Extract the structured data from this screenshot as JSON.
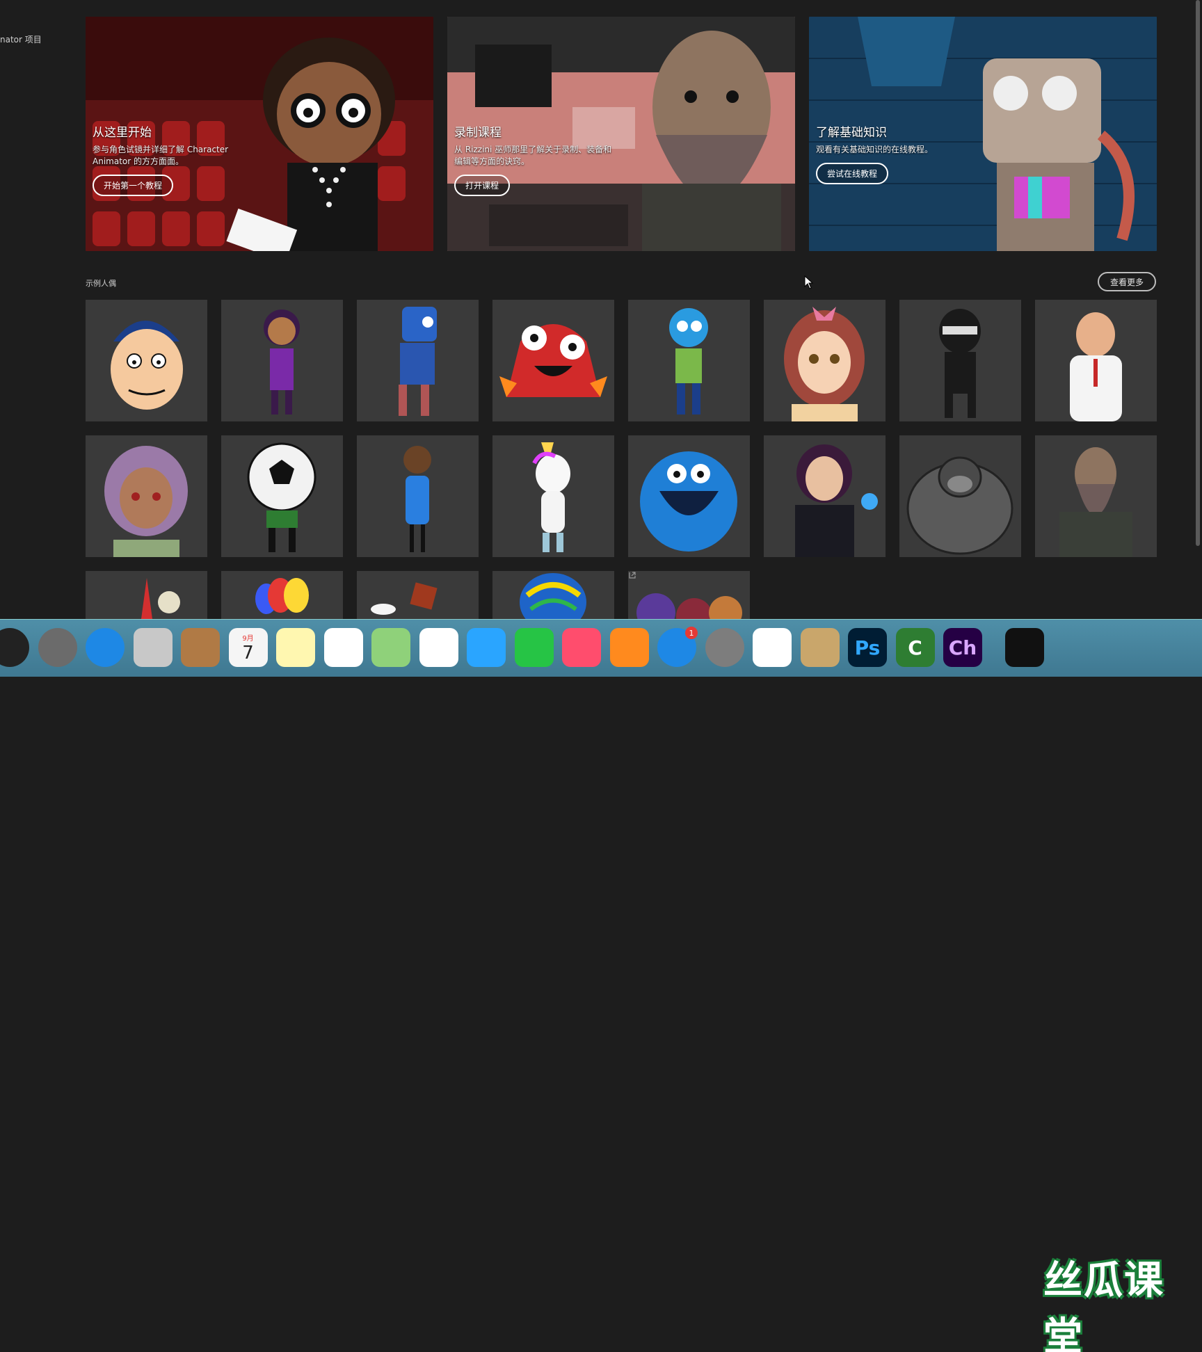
{
  "sidebar": {
    "project_label": "nator 项目"
  },
  "heroes": [
    {
      "title": "从这里开始",
      "desc": "参与角色试镜并详细了解 Character Animator 的方方面面。",
      "button": "开始第一个教程"
    },
    {
      "title": "录制课程",
      "desc": "从 Rizzini 巫师那里了解关于录制、装备和编辑等方面的诀窍。",
      "button": "打开课程"
    },
    {
      "title": "了解基础知识",
      "desc": "观看有关基础知识的在线教程。",
      "button": "尝试在线教程"
    }
  ],
  "puppets": {
    "section_title": "示例人偶",
    "see_more": "查看更多",
    "items": [
      "boy-blue-hair",
      "girl-purple-dress",
      "blue-robot",
      "red-monster",
      "blue-cat",
      "anime-girl",
      "ninja",
      "doctor",
      "catgirl-purple",
      "soccer-ball",
      "blue-shirt-kid",
      "unicorn",
      "blue-beast",
      "witch-girl",
      "gorilla",
      "wizard",
      "red-cone",
      "balloons",
      "paper-crane",
      "colorful-head",
      "group-characters"
    ]
  },
  "dock": {
    "apps": [
      {
        "name": "siri-icon",
        "color": "#222"
      },
      {
        "name": "launchpad-icon",
        "color": "#6b6b6b"
      },
      {
        "name": "safari-icon",
        "color": "#1e88e5"
      },
      {
        "name": "mail-stamp-icon",
        "color": "#c8c8c8"
      },
      {
        "name": "contacts-icon",
        "color": "#b07a45"
      },
      {
        "name": "calendar-icon",
        "color": "#f5f5f5",
        "label": "9月",
        "day": "7"
      },
      {
        "name": "notes-icon",
        "color": "#fff7b0"
      },
      {
        "name": "reminders-icon",
        "color": "#ffffff"
      },
      {
        "name": "maps-icon",
        "color": "#8fd17a"
      },
      {
        "name": "photos-icon",
        "color": "#ffffff"
      },
      {
        "name": "messages-icon",
        "color": "#2aa5ff"
      },
      {
        "name": "facetime-icon",
        "color": "#26c445"
      },
      {
        "name": "music-icon",
        "color": "#ff4d6d"
      },
      {
        "name": "books-icon",
        "color": "#ff8a1e"
      },
      {
        "name": "appstore-icon",
        "color": "#1e88e5",
        "badge": "1"
      },
      {
        "name": "system-preferences-icon",
        "color": "#7d7d7d"
      },
      {
        "name": "baidu-netdisk-icon",
        "color": "#ffffff"
      },
      {
        "name": "archive-utility-icon",
        "color": "#c9a66b"
      },
      {
        "name": "photoshop-icon",
        "color": "#001d34",
        "text": "Ps"
      },
      {
        "name": "camtasia-icon",
        "color": "#2e7d32",
        "text": "C"
      },
      {
        "name": "character-animator-icon",
        "color": "#250044",
        "text": "Ch"
      },
      {
        "name": "screen-recorder-icon",
        "color": "#111111"
      }
    ]
  },
  "watermark": "丝瓜课堂"
}
